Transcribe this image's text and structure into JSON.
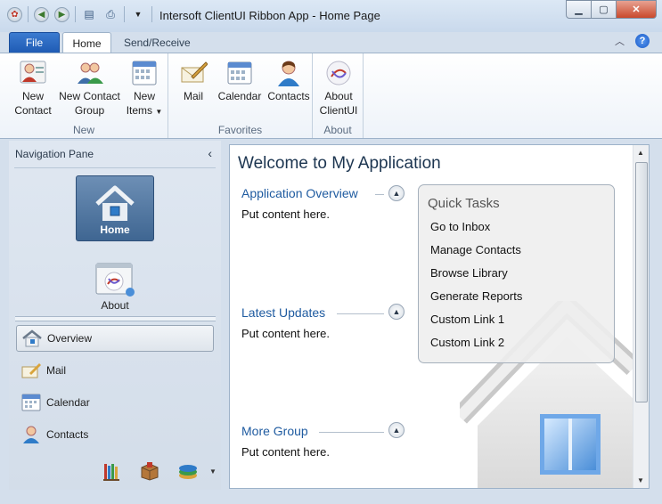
{
  "window": {
    "title": "Intersoft ClientUI Ribbon App - Home Page"
  },
  "tabs": {
    "file": "File",
    "home": "Home",
    "send_receive": "Send/Receive"
  },
  "ribbon": {
    "groups": [
      {
        "label": "New",
        "buttons": [
          {
            "line1": "New",
            "line2": "Contact"
          },
          {
            "line1": "New Contact",
            "line2": "Group"
          },
          {
            "line1": "New",
            "line2": "Items"
          }
        ]
      },
      {
        "label": "Favorites",
        "buttons": [
          {
            "line1": "Mail"
          },
          {
            "line1": "Calendar"
          },
          {
            "line1": "Contacts"
          }
        ]
      },
      {
        "label": "About",
        "buttons": [
          {
            "line1": "About",
            "line2": "ClientUI"
          }
        ]
      }
    ]
  },
  "nav": {
    "header": "Navigation Pane",
    "big": [
      {
        "label": "Home"
      },
      {
        "label": "About"
      }
    ],
    "items": [
      {
        "label": "Overview",
        "selected": true
      },
      {
        "label": "Mail"
      },
      {
        "label": "Calendar"
      },
      {
        "label": "Contacts"
      }
    ]
  },
  "content": {
    "title": "Welcome to My Application",
    "sections": [
      {
        "title": "Application Overview",
        "body": "Put content here."
      },
      {
        "title": "Latest Updates",
        "body": "Put content here."
      },
      {
        "title": "More Group",
        "body": "Put content here."
      }
    ],
    "quick_tasks": {
      "title": "Quick Tasks",
      "links": [
        "Go to Inbox",
        "Manage Contacts",
        "Browse Library",
        "Generate Reports",
        "Custom Link 1",
        "Custom Link 2"
      ]
    }
  },
  "colors": {
    "file_tab": "#1f5bb4",
    "accent_text": "#1f5ba0",
    "title_text": "#1c3550",
    "nav_home_tile": "#3f6692"
  }
}
